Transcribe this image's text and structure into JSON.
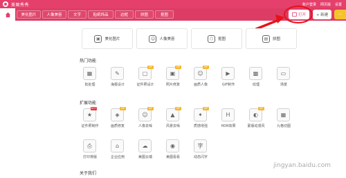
{
  "app": {
    "title": "美图秀秀"
  },
  "titlebar": {
    "account": "账户登录",
    "cloud": "网页版",
    "settings": "设置"
  },
  "tabs": [
    "美化图片",
    "人像美容",
    "文字",
    "贴纸饰品",
    "边框",
    "拼图",
    "抠图"
  ],
  "toolbar": {
    "open": "打开",
    "new": "+ 新建",
    "more": "···"
  },
  "cards": [
    {
      "label": "美化图片",
      "icon": "image-icon"
    },
    {
      "label": "人像美容",
      "icon": "face-icon"
    },
    {
      "label": "抠图",
      "icon": "cutout-icon"
    },
    {
      "label": "拼图",
      "icon": "collage-icon"
    }
  ],
  "sections": {
    "hot": "热门功能",
    "extend": "扩展功能",
    "about": "关于我们"
  },
  "hot_items": [
    {
      "label": "批处理",
      "badge": ""
    },
    {
      "label": "海报设计",
      "badge": ""
    },
    {
      "label": "证件照设计",
      "badge": "VIP"
    },
    {
      "label": "照片修复",
      "badge": "VIP"
    },
    {
      "label": "画质人像",
      "badge": "VIP"
    },
    {
      "label": "GIF制作",
      "badge": ""
    },
    {
      "label": "纹理",
      "badge": ""
    },
    {
      "label": "场景",
      "badge": ""
    }
  ],
  "ext_row1": [
    {
      "label": "证件照制作",
      "badge": "HOT"
    },
    {
      "label": "画质修复",
      "badge": "VIP"
    },
    {
      "label": "人像去噪",
      "badge": "VIP"
    },
    {
      "label": "风景去噪",
      "badge": "VIP"
    },
    {
      "label": "质感增强",
      "badge": "VIP"
    },
    {
      "label": "HDR效果",
      "badge": ""
    },
    {
      "label": "蒙版动漫风",
      "badge": "VIP"
    },
    {
      "label": "九格切图",
      "badge": ""
    }
  ],
  "ext_row2": [
    {
      "label": "打印排版",
      "badge": ""
    },
    {
      "label": "企业应用",
      "badge": ""
    },
    {
      "label": "美图云端",
      "badge": ""
    },
    {
      "label": "美图看看",
      "badge": ""
    },
    {
      "label": "动态闪字",
      "badge": ""
    }
  ],
  "watermark": "jingyan.baidu.com"
}
